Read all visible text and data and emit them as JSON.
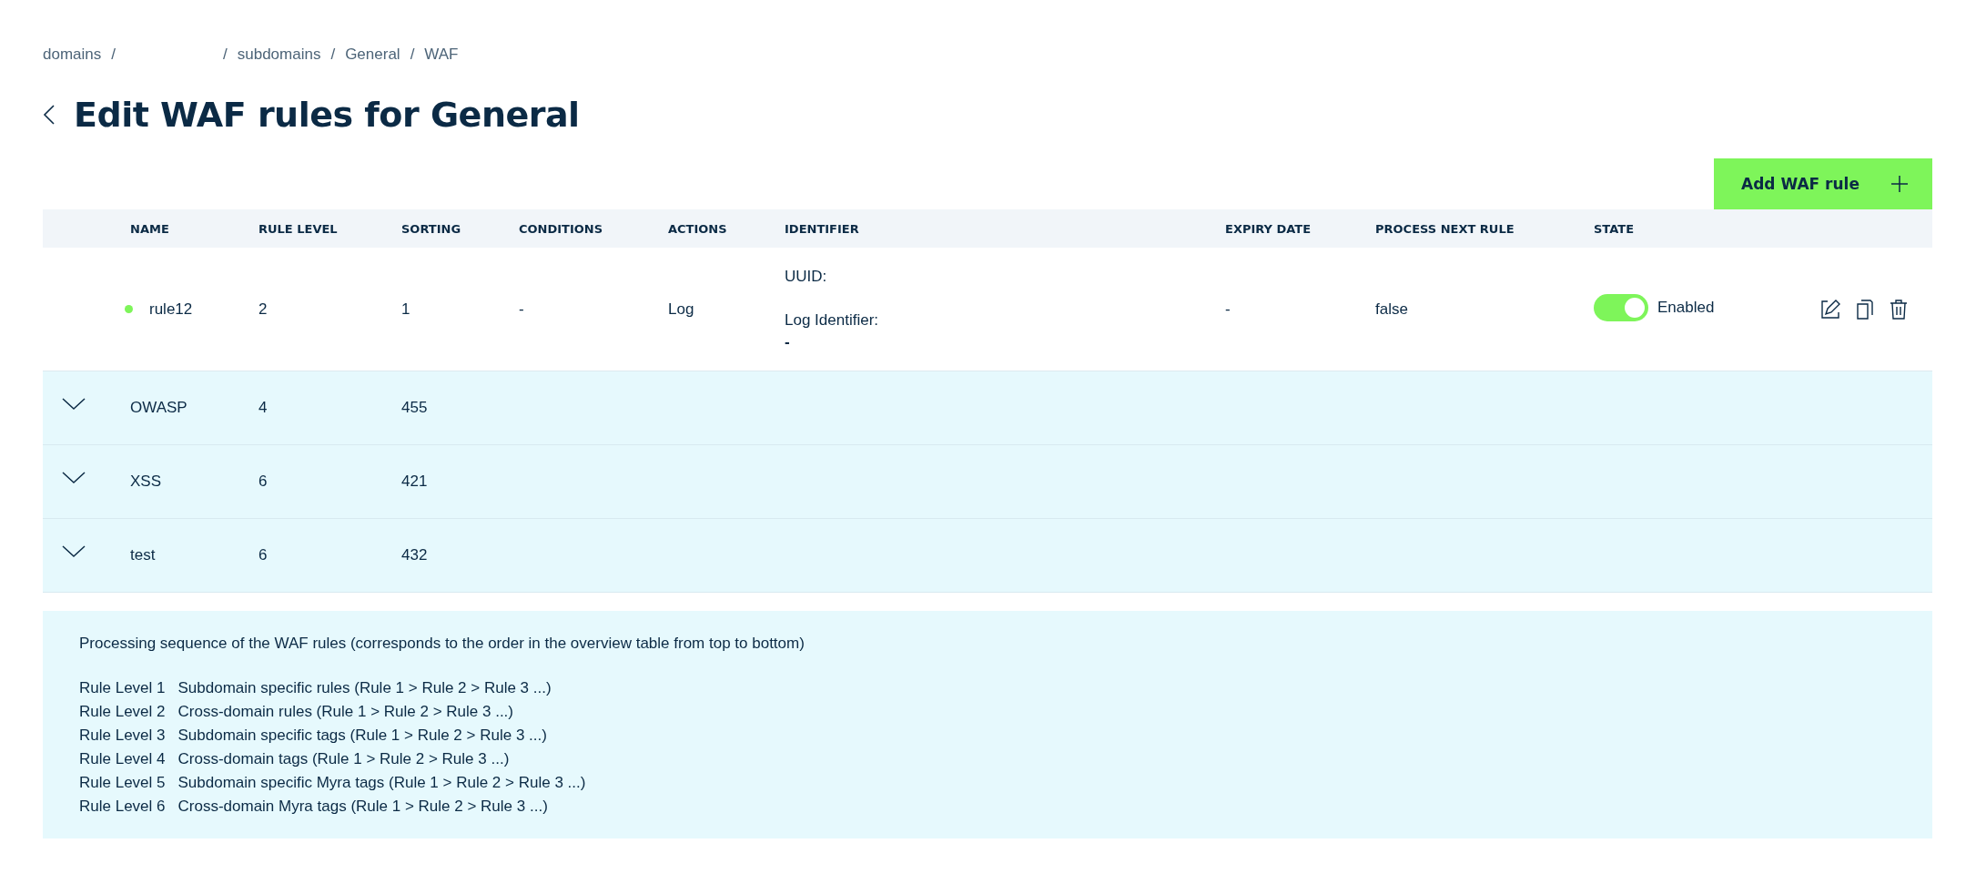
{
  "breadcrumb": {
    "separator": "/",
    "items": [
      {
        "kind": "link",
        "label": "domains"
      },
      {
        "kind": "hidden"
      },
      {
        "kind": "link",
        "label": "subdomains"
      },
      {
        "kind": "link",
        "label": "General"
      },
      {
        "kind": "current",
        "label": "WAF"
      }
    ]
  },
  "title": "Edit WAF rules for General",
  "add_button": "Add WAF rule",
  "table": {
    "columns": [
      "NAME",
      "RULE LEVEL",
      "SORTING",
      "CONDITIONS",
      "ACTIONS",
      "IDENTIFIER",
      "EXPIRY DATE",
      "PROCESS NEXT RULE",
      "STATE"
    ],
    "rules": [
      {
        "name": "rule12",
        "color": "#7ef55a",
        "rule_level": "2",
        "sorting": "1",
        "conditions": "-",
        "actions": "Log",
        "identifier": [
          {
            "label": "UUID:"
          },
          {
            "label": "Log Identifier:",
            "value": "-"
          }
        ],
        "expiry_date": "-",
        "process_next_rule": "false",
        "enabled": true,
        "state_label": "Enabled"
      }
    ],
    "groups": [
      {
        "name": "OWASP",
        "rule_level": "4",
        "sorting": "455",
        "expanded": false
      },
      {
        "name": "XSS",
        "rule_level": "6",
        "sorting": "421",
        "expanded": false
      },
      {
        "name": "test",
        "rule_level": "6",
        "sorting": "432",
        "expanded": false
      }
    ]
  },
  "info": {
    "intro": "Processing sequence of the WAF rules (corresponds to the order in the overview table from top to bottom)",
    "levels": [
      {
        "level": "Rule Level 1",
        "text": "Subdomain specific rules (Rule 1 > Rule 2 > Rule 3 ...)"
      },
      {
        "level": "Rule Level 2",
        "text": "Cross-domain rules (Rule 1 > Rule 2 > Rule 3 ...)"
      },
      {
        "level": "Rule Level 3",
        "text": "Subdomain specific tags (Rule 1 > Rule 2 > Rule 3 ...)"
      },
      {
        "level": "Rule Level 4",
        "text": "Cross-domain tags (Rule 1 > Rule 2 > Rule 3 ...)"
      },
      {
        "level": "Rule Level 5",
        "text": "Subdomain specific Myra tags (Rule 1 > Rule 2 > Rule 3 ...)"
      },
      {
        "level": "Rule Level 6",
        "text": "Cross-domain Myra tags (Rule 1 > Rule 2 > Rule 3 ...)"
      }
    ]
  }
}
